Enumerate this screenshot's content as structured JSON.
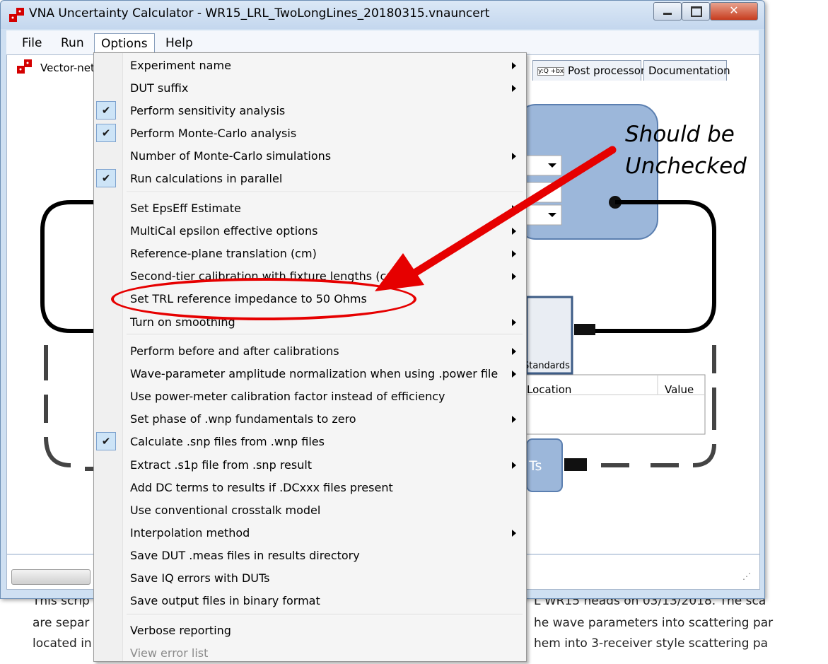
{
  "window": {
    "title": "VNA Uncertainty Calculator - WR15_LRL_TwoLongLines_20180315.vnauncert",
    "controls": {
      "close": "✕"
    }
  },
  "menubar": [
    "File",
    "Run",
    "Options",
    "Help"
  ],
  "left_panel_label": "Vector-netw",
  "tabs": {
    "post_processors": "Post processors",
    "documentation": "Documentation",
    "post_icon": "y:Q +bx"
  },
  "options_menu": {
    "items": [
      {
        "label": "Experiment name",
        "checked": false,
        "submenu": true
      },
      {
        "label": "DUT suffix",
        "checked": false,
        "submenu": true
      },
      {
        "label": "Perform sensitivity analysis",
        "checked": true,
        "submenu": false
      },
      {
        "label": "Perform Monte-Carlo analysis",
        "checked": true,
        "submenu": false
      },
      {
        "label": "Number of Monte-Carlo simulations",
        "checked": false,
        "submenu": true
      },
      {
        "label": "Run calculations in parallel",
        "checked": true,
        "submenu": false
      },
      {
        "label": "Set EpsEff Estimate",
        "checked": false,
        "submenu": true
      },
      {
        "label": "MultiCal epsilon effective options",
        "checked": false,
        "submenu": true
      },
      {
        "label": "Reference-plane translation (cm)",
        "checked": false,
        "submenu": true
      },
      {
        "label": "Second-tier calibration with fixture lengths (cm)",
        "checked": false,
        "submenu": true
      },
      {
        "label": "Set TRL reference impedance to 50 Ohms",
        "checked": false,
        "submenu": false
      },
      {
        "label": "Turn on smoothing",
        "checked": false,
        "submenu": true
      },
      {
        "label": "Perform before and after calibrations",
        "checked": false,
        "submenu": true
      },
      {
        "label": "Wave-parameter amplitude normalization when using .power file",
        "checked": false,
        "submenu": true
      },
      {
        "label": "Use power-meter calibration factor instead of efficiency",
        "checked": false,
        "submenu": false
      },
      {
        "label": "Set phase of .wnp fundamentals to zero",
        "checked": false,
        "submenu": true
      },
      {
        "label": "Calculate .snp files from .wnp files",
        "checked": true,
        "submenu": false
      },
      {
        "label": "Extract .s1p file from .snp result",
        "checked": false,
        "submenu": true
      },
      {
        "label": "Add DC terms to results if .DCxxx files present",
        "checked": false,
        "submenu": false
      },
      {
        "label": "Use conventional crosstalk model",
        "checked": false,
        "submenu": false
      },
      {
        "label": "Interpolation method",
        "checked": false,
        "submenu": true
      },
      {
        "label": "Save DUT .meas files in results directory",
        "checked": false,
        "submenu": false
      },
      {
        "label": "Save IQ errors with DUTs",
        "checked": false,
        "submenu": false
      },
      {
        "label": "Save output files in binary format",
        "checked": false,
        "submenu": false
      },
      {
        "label": "Verbose reporting",
        "checked": false,
        "submenu": false
      },
      {
        "label": "View error list",
        "checked": false,
        "submenu": false,
        "disabled": true
      }
    ]
  },
  "diagram": {
    "standards_label": "Standards",
    "table_headers": [
      "Location",
      "Value"
    ],
    "duts_fragment": "Ts"
  },
  "background_text": {
    "line1_left": "This scrip",
    "line1_right": "L WR15 heads on 03/13/2018. The sca",
    "line2_left": "are separ",
    "line2_right": "he wave parameters into scattering par",
    "line3_left": "located in",
    "line3_right": "hem into 3-receiver style scattering pa"
  },
  "annotation": {
    "line1": "Should be",
    "line2": "Unchecked",
    "color": "#e60000"
  }
}
